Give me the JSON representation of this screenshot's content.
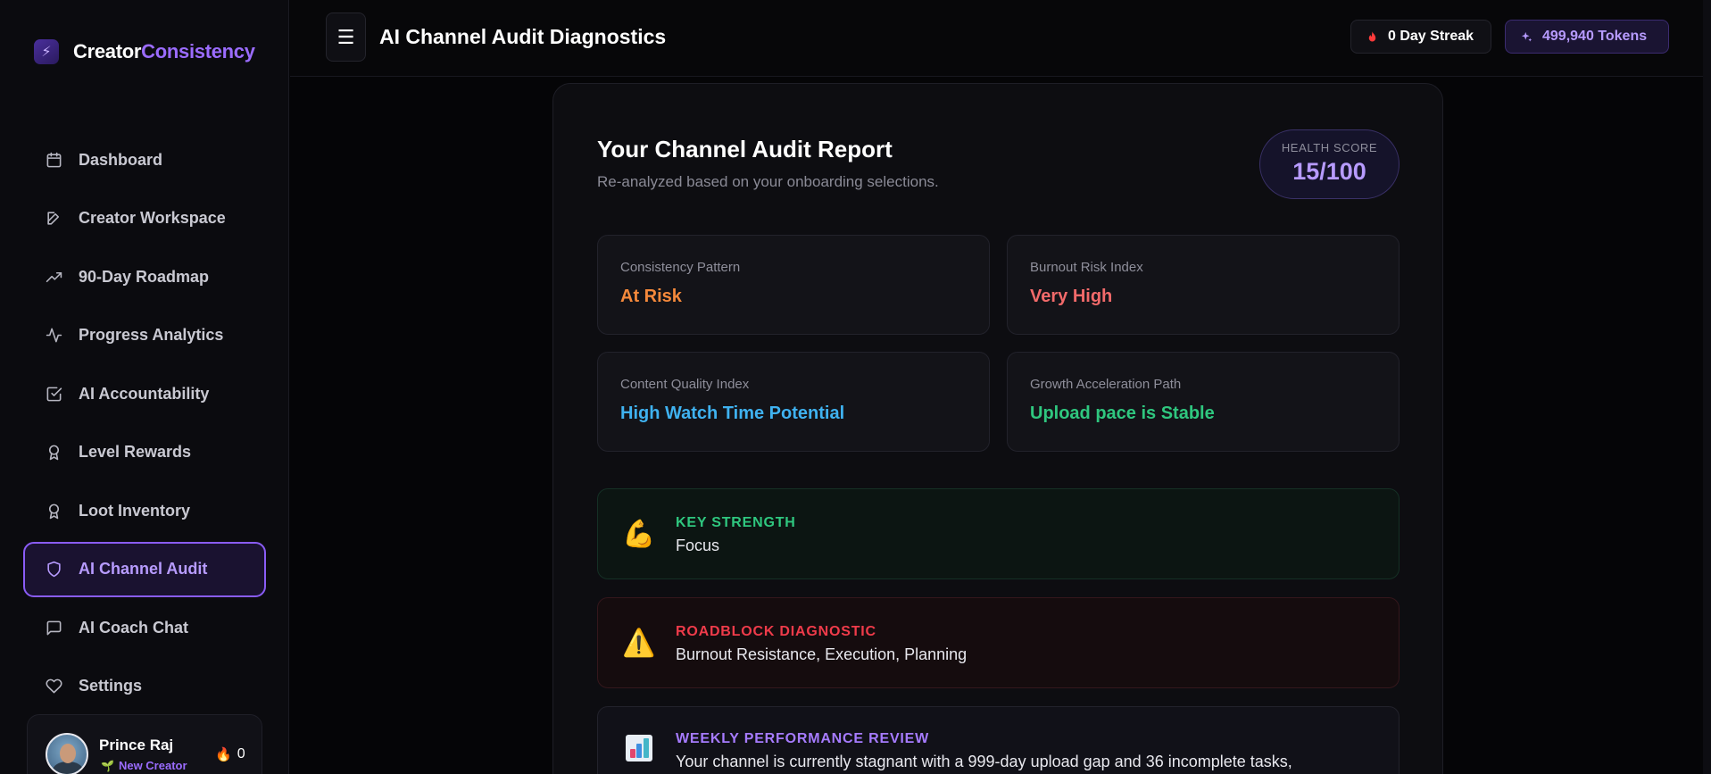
{
  "brand": {
    "part1": "Creator",
    "part2": "Consistency"
  },
  "sidebar": {
    "items": [
      {
        "label": "Dashboard",
        "icon": "calendar-icon"
      },
      {
        "label": "Creator Workspace",
        "icon": "edit-icon"
      },
      {
        "label": "90-Day Roadmap",
        "icon": "trending-up-icon"
      },
      {
        "label": "Progress Analytics",
        "icon": "activity-icon"
      },
      {
        "label": "AI Accountability",
        "icon": "check-square-icon"
      },
      {
        "label": "Level Rewards",
        "icon": "award-icon"
      },
      {
        "label": "Loot Inventory",
        "icon": "award-icon"
      },
      {
        "label": "AI Channel Audit",
        "icon": "shield-icon",
        "active": true
      },
      {
        "label": "AI Coach Chat",
        "icon": "message-square-icon"
      },
      {
        "label": "Settings",
        "icon": "heart-icon"
      }
    ]
  },
  "user": {
    "name": "Prince Raj",
    "level": "New Creator",
    "streak": "0"
  },
  "header": {
    "title": "AI Channel Audit Diagnostics",
    "streak": "0 Day Streak",
    "tokens": "499,940 Tokens"
  },
  "report": {
    "title": "Your Channel Audit Report",
    "subtitle": "Re-analyzed based on your onboarding selections.",
    "health_label": "HEALTH SCORE",
    "health_value": "15/100",
    "metrics": [
      {
        "label": "Consistency Pattern",
        "value": "At Risk",
        "color": "#f5893b"
      },
      {
        "label": "Burnout Risk Index",
        "value": "Very High",
        "color": "#f26a6a"
      },
      {
        "label": "Content Quality Index",
        "value": "High Watch Time Potential",
        "color": "#3fb2f0"
      },
      {
        "label": "Growth Acceleration Path",
        "value": "Upload pace is Stable",
        "color": "#2fc77f"
      }
    ],
    "strength": {
      "head": "KEY STRENGTH",
      "body": "Focus",
      "color": "#2fc77f",
      "emoji": "💪"
    },
    "roadblock": {
      "head": "ROADBLOCK DIAGNOSTIC",
      "body": "Burnout Resistance, Execution, Planning",
      "color": "#ef3b4a",
      "emoji": "⚠️"
    },
    "review": {
      "head": "WEEKLY PERFORMANCE REVIEW",
      "body": "Your channel is currently stagnant with a 999-day upload gap and 36 incomplete tasks,",
      "color": "#a67bff"
    }
  }
}
